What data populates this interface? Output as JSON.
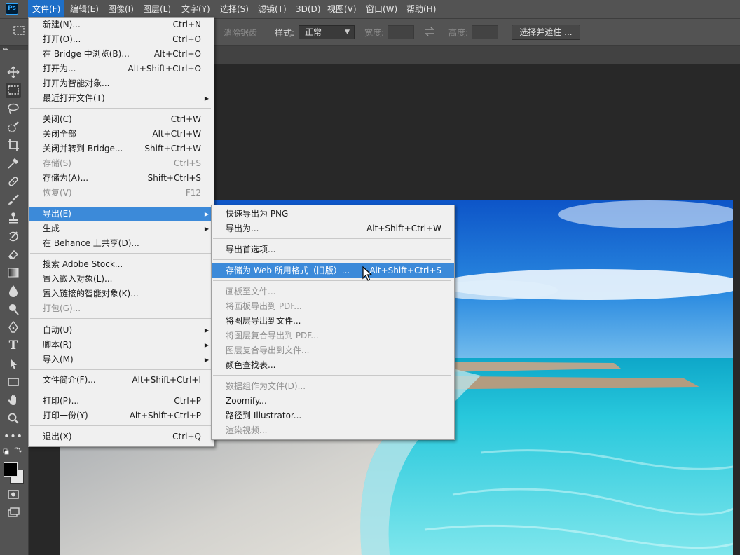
{
  "app": {
    "logo": "Ps"
  },
  "menubar": {
    "items": [
      "文件(F)",
      "编辑(E)",
      "图像(I)",
      "图层(L)",
      "文字(Y)",
      "选择(S)",
      "滤镜(T)",
      "3D(D)",
      "视图(V)",
      "窗口(W)",
      "帮助(H)"
    ],
    "active_index": 0
  },
  "options_bar": {
    "antialias_label": "消除锯齿",
    "style_label": "样式:",
    "style_value": "正常",
    "width_label": "宽度:",
    "height_label": "高度:",
    "select_mask_label": "选择并遮住 ..."
  },
  "file_menu": {
    "items": [
      {
        "label": "新建(N)...",
        "shortcut": "Ctrl+N"
      },
      {
        "label": "打开(O)...",
        "shortcut": "Ctrl+O"
      },
      {
        "label": "在 Bridge 中浏览(B)...",
        "shortcut": "Alt+Ctrl+O"
      },
      {
        "label": "打开为...",
        "shortcut": "Alt+Shift+Ctrl+O"
      },
      {
        "label": "打开为智能对象...",
        "shortcut": ""
      },
      {
        "label": "最近打开文件(T)",
        "shortcut": ""
      },
      {
        "label": "关闭(C)",
        "shortcut": "Ctrl+W"
      },
      {
        "label": "关闭全部",
        "shortcut": "Alt+Ctrl+W"
      },
      {
        "label": "关闭并转到 Bridge...",
        "shortcut": "Shift+Ctrl+W"
      },
      {
        "label": "存储(S)",
        "shortcut": "Ctrl+S"
      },
      {
        "label": "存储为(A)...",
        "shortcut": "Shift+Ctrl+S"
      },
      {
        "label": "恢复(V)",
        "shortcut": "F12"
      },
      {
        "label": "导出(E)",
        "shortcut": ""
      },
      {
        "label": "生成",
        "shortcut": ""
      },
      {
        "label": "在 Behance 上共享(D)...",
        "shortcut": ""
      },
      {
        "label": "搜索 Adobe Stock...",
        "shortcut": ""
      },
      {
        "label": "置入嵌入对象(L)...",
        "shortcut": ""
      },
      {
        "label": "置入链接的智能对象(K)...",
        "shortcut": ""
      },
      {
        "label": "打包(G)...",
        "shortcut": ""
      },
      {
        "label": "自动(U)",
        "shortcut": ""
      },
      {
        "label": "脚本(R)",
        "shortcut": ""
      },
      {
        "label": "导入(M)",
        "shortcut": ""
      },
      {
        "label": "文件简介(F)...",
        "shortcut": "Alt+Shift+Ctrl+I"
      },
      {
        "label": "打印(P)...",
        "shortcut": "Ctrl+P"
      },
      {
        "label": "打印一份(Y)",
        "shortcut": "Alt+Shift+Ctrl+P"
      },
      {
        "label": "退出(X)",
        "shortcut": "Ctrl+Q"
      }
    ]
  },
  "export_menu": {
    "items": [
      {
        "label": "快速导出为 PNG",
        "shortcut": ""
      },
      {
        "label": "导出为...",
        "shortcut": "Alt+Shift+Ctrl+W"
      },
      {
        "label": "导出首选项...",
        "shortcut": ""
      },
      {
        "label": "存储为 Web 所用格式（旧版）...",
        "shortcut": "Alt+Shift+Ctrl+S"
      },
      {
        "label": "画板至文件...",
        "shortcut": ""
      },
      {
        "label": "将画板导出到 PDF...",
        "shortcut": ""
      },
      {
        "label": "将图层导出到文件...",
        "shortcut": ""
      },
      {
        "label": "将图层复合导出到 PDF...",
        "shortcut": ""
      },
      {
        "label": "图层复合导出到文件...",
        "shortcut": ""
      },
      {
        "label": "颜色查找表...",
        "shortcut": ""
      },
      {
        "label": "数据组作为文件(D)...",
        "shortcut": ""
      },
      {
        "label": "Zoomify...",
        "shortcut": ""
      },
      {
        "label": "路径到 Illustrator...",
        "shortcut": ""
      },
      {
        "label": "渲染视频...",
        "shortcut": ""
      }
    ]
  },
  "colors": {
    "highlight": "#3c8ad9",
    "menubar_active": "#1e6fc8",
    "chrome": "#535353",
    "workspace": "#282828"
  }
}
